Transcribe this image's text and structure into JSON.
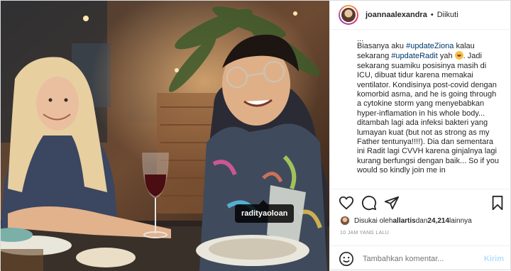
{
  "photo": {
    "alt": "",
    "tag_label": "radityaoloan"
  },
  "header": {
    "username": "joannaalexandra",
    "separator": "•",
    "follow_status": "Diikuti"
  },
  "caption": {
    "more_indicator": "...",
    "part1": "Biasanya aku ",
    "hashtag1": "#updateZiona",
    "part2": " kalau sekarang ",
    "hashtag2": "#updateRadit",
    "part3": " yah ",
    "part4": ". Jadi sekarang suamiku posisinya masih di ICU, dibuat tidur karena memakai ventilator. Kondisinya post-covid dengan komorbid asma, and he is going through a cytokine storm yang menyebabkan hyper-inflamation in his whole body... ditambah lagi ada infeksi bakteri yang lumayan kuat (but not as strong as my Father tentunya!!!!). Dia dan sementara ini Radit lagi CVVH karena ginjalnya lagi kurang berfungsi dengan baik... So if you would so kindly join me in"
  },
  "actions": {
    "like_icon": "heart-icon",
    "comment_icon": "comment-icon",
    "share_icon": "share-icon",
    "save_icon": "bookmark-icon"
  },
  "likes": {
    "prefix": "Disukai oleh ",
    "user": "allartis",
    "middle": " dan ",
    "count": "24,214",
    "suffix": " lainnya"
  },
  "timestamp": "10 JAM YANG LALU",
  "comment_box": {
    "emoji_icon": "smiley-icon",
    "placeholder": "Tambahkan komentar...",
    "post_label": "Kirim"
  }
}
